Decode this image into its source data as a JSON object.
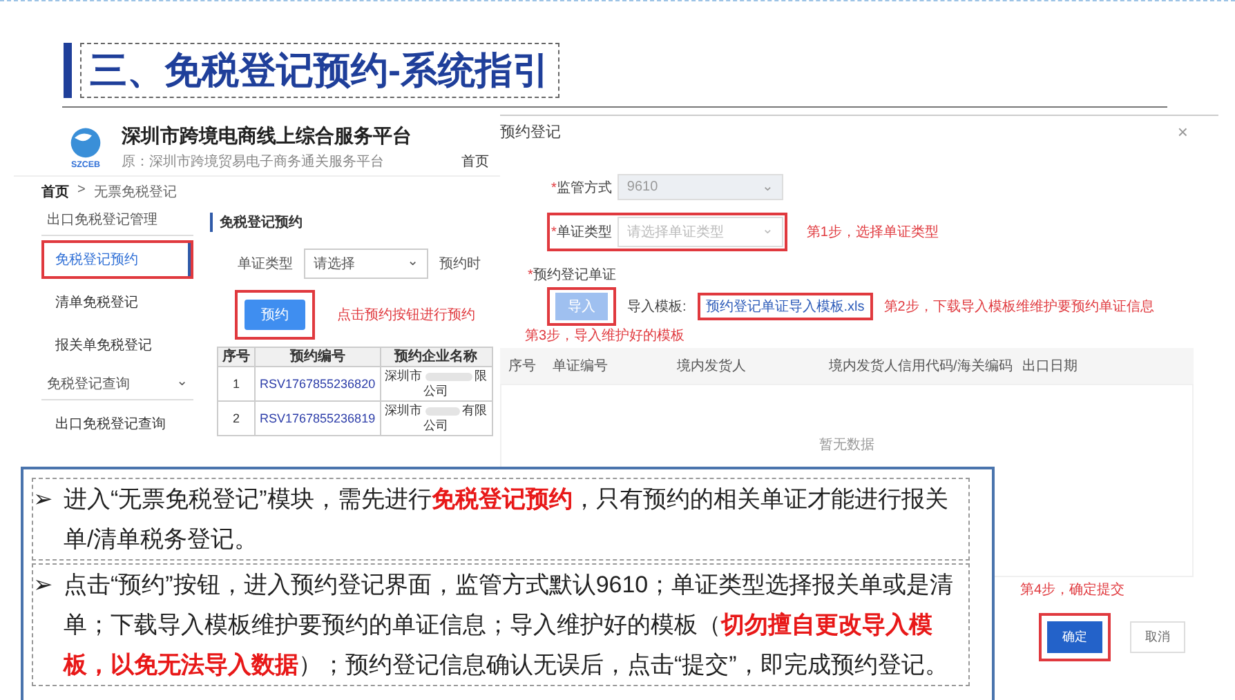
{
  "slide_title": "三、免税登记预约-系统指引",
  "portal": {
    "logo_text": "SZCEB",
    "name": "深圳市跨境电商线上综合服务平台",
    "subtitle": "原：深圳市跨境贸易电子商务通关服务平台",
    "nav": "首页",
    "breadcrumb": {
      "home": "首页",
      "separator": ">",
      "current": "无票免税登记"
    },
    "sidebar": [
      {
        "label": "出口免税登记管理",
        "children": [
          {
            "label": "免税登记预约",
            "selected": true,
            "callout": true
          },
          {
            "label": "清单免税登记",
            "selected": false,
            "callout": false
          },
          {
            "label": "报关单免税登记",
            "selected": false,
            "callout": false
          }
        ]
      },
      {
        "label": "免税登记查询",
        "chevron": "⌄",
        "children": [
          {
            "label": "出口免税登记查询",
            "selected": false,
            "callout": false
          }
        ]
      }
    ],
    "section_title": "免税登记预约",
    "filter": {
      "label": "单证类型",
      "value": "请选择",
      "chevron": "⌄",
      "next_label": "预约时"
    },
    "reserve_button": {
      "label": "预约",
      "callout": true
    },
    "annotation": "点击预约按钮进行预约",
    "table": {
      "columns": [
        "序号",
        "预约编号",
        "预约企业名称"
      ],
      "rows": [
        {
          "index": "1",
          "number": "RSV1767855236820",
          "company_start": "深圳市",
          "company_end": "限",
          "company_line_2": "公司"
        },
        {
          "index": "2",
          "number": "RSV1767855236819",
          "company_start": "深圳市",
          "company_end": "有限",
          "company_line_2": "公司"
        }
      ]
    }
  },
  "dialog": {
    "title": "预约登记",
    "close": "×",
    "fields": [
      {
        "label": "监管方式",
        "required_mark": "*",
        "value": "9610",
        "chevron": "⌄",
        "disabled": true,
        "callout": false
      },
      {
        "label": "单证类型",
        "required_mark": "*",
        "placeholder": "请选择单证类型",
        "chevron": "⌄",
        "disabled": false,
        "callout": true,
        "annotation": "第1步，选择单证类型"
      }
    ],
    "upload": {
      "label": "预约登记单证",
      "required_mark": "*",
      "button": {
        "label": "导入",
        "disabled": true,
        "callout": true
      },
      "template_label": "导入模板:",
      "template_link": {
        "text": "预约登记单证导入模板.xls",
        "callout": true
      },
      "annotation": "第2步，下载导入模板维维护要预约单证信息",
      "annotation_below": "第3步，导入维护好的模板"
    },
    "table": {
      "columns": [
        "序号",
        "单证编号",
        "境内发货人",
        "境内发货人信用代码/海关编码",
        "出口日期"
      ],
      "empty_text": "暂无数据"
    },
    "annotation": "第4步，确定提交",
    "buttons": [
      {
        "label": "确定",
        "kind": "primary",
        "callout": true
      },
      {
        "label": "取消",
        "kind": "default",
        "callout": false
      }
    ]
  },
  "notes": [
    {
      "bullet": "➢",
      "text": "进入“无票免税登记”模块，需先进行**免税登记预约**，只有预约的相关单证才能进行报关单/清单税务登记。"
    },
    {
      "bullet": "➢",
      "text": "点击“预约”按钮，进入预约登记界面，监管方式默认9610；单证类型选择报关单或是清单；下载导入模板维护要预约的单证信息；导入维护好的模板（**切勿擅自更改导入模板，以免无法导入数据**）；预约登记信息确认无误后，点击“提交”，即完成预约登记。"
    }
  ]
}
